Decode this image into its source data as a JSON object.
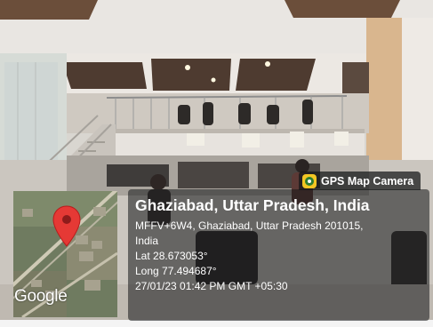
{
  "badge": {
    "label": "GPS Map Camera",
    "icon": "gps-map-camera-logo-icon"
  },
  "location": {
    "title": "Ghaziabad, Uttar Pradesh, India",
    "address_line_1": "MFFV+6W4, Ghaziabad, Uttar Pradesh 201015,",
    "address_line_2": "India",
    "latitude": "Lat 28.673053°",
    "longitude": "Long 77.494687°",
    "timestamp": "27/01/23 01:42 PM GMT +05:30"
  },
  "map": {
    "provider_logo": "Google",
    "marker_icon": "map-pin-icon",
    "marker_color": "#e53935"
  }
}
